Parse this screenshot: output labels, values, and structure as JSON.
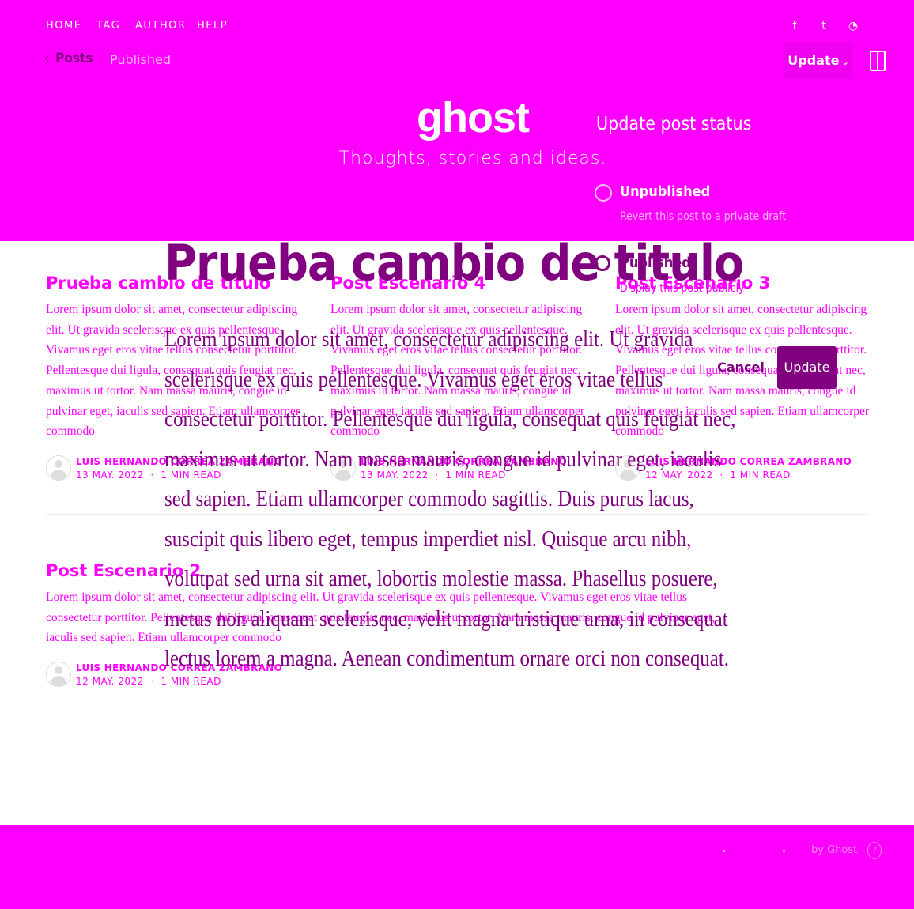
{
  "nav": {
    "items": [
      "HOME",
      "TAG",
      "AUTHOR",
      "HELP"
    ],
    "social": [
      {
        "icon": "facebook-icon",
        "glyph": "f"
      },
      {
        "icon": "twitter-icon",
        "glyph": "t"
      },
      {
        "icon": "rss-icon",
        "glyph": "◔"
      }
    ]
  },
  "editor_bar": {
    "back_label": "Posts",
    "status": "Published",
    "update_label": "Update"
  },
  "site": {
    "title": "ghost",
    "description": "Thoughts, stories and ideas."
  },
  "popup": {
    "title": "Update post status",
    "options": [
      {
        "title": "Unpublished",
        "description": "Revert this post to a private draft"
      },
      {
        "title": "Published",
        "description": "Display this post publicly"
      }
    ],
    "cancel_label": "Cancel",
    "confirm_label": "Update"
  },
  "editor": {
    "title": "Prueba cambio de titulo",
    "body": "Lorem ipsum dolor sit amet, consectetur adipiscing elit. Ut gravida scelerisque ex quis pellentesque. Vivamus eget eros vitae tellus consectetur porttitor. Pellentesque dui ligula, consequat quis feugiat nec, maximus ut tortor. Nam massa mauris, congue id pulvinar eget, iaculis sed sapien. Etiam ullamcorper commodo sagittis. Duis purus lacus, suscipit quis libero eget, tempus imperdiet nisl. Quisque arcu nibh, volutpat sed urna sit amet, lobortis molestie massa. Phasellus posuere, metus non aliquam scelerisque, velit magna tristique urna, in consequat lectus lorem a magna. Aenean condimentum ornare orci non consequat."
  },
  "posts": [
    {
      "title": "Prueba cambio de titulo",
      "excerpt": "Lorem ipsum dolor sit amet, consectetur adipiscing elit. Ut gravida scelerisque ex quis pellentesque. Vivamus eget eros vitae tellus consectetur porttitor. Pellentesque dui ligula, consequat quis feugiat nec, maximus ut tortor. Nam massa mauris, congue id pulvinar eget, iaculis sed sapien. Etiam ullamcorper commodo",
      "author": "LUIS HERNANDO CORREA ZAMBRANO",
      "date": "13 MAY. 2022",
      "read": "1 MIN READ"
    },
    {
      "title": "Post Escenario 4",
      "excerpt": "Lorem ipsum dolor sit amet, consectetur adipiscing elit. Ut gravida scelerisque ex quis pellentesque. Vivamus eget eros vitae tellus consectetur porttitor. Pellentesque dui ligula, consequat quis feugiat nec, maximus ut tortor. Nam massa mauris, congue id pulvinar eget, iaculis sed sapien. Etiam ullamcorper commodo",
      "author": "LUIS HERNANDO CORREA ZAMBRANO",
      "date": "13 MAY. 2022",
      "read": "1 MIN READ"
    },
    {
      "title": "Post Escenario 3",
      "excerpt": "Lorem ipsum dolor sit amet, consectetur adipiscing elit. Ut gravida scelerisque ex quis pellentesque. Vivamus eget eros vitae tellus consectetur porttitor. Pellentesque dui ligula, consequat quis feugiat nec, maximus ut tortor. Nam massa mauris, congue id pulvinar eget, iaculis sed sapien. Etiam ullamcorper commodo",
      "author": "LUIS HERNANDO CORREA ZAMBRANO",
      "date": "12 MAY. 2022",
      "read": "1 MIN READ"
    },
    {
      "title": "Post Escenario 2",
      "excerpt": "Lorem ipsum dolor sit amet, consectetur adipiscing elit. Ut gravida scelerisque ex quis pellentesque. Vivamus eget eros vitae tellus consectetur porttitor. Pellentesque dui ligula, consequat quis feugiat nec, maximus ut tortor. Nam massa mauris, congue id pulvinar eget, iaculis sed sapien. Etiam ullamcorper commodo",
      "author": "LUIS HERNANDO CORREA ZAMBRANO",
      "date": "12 MAY. 2022",
      "read": "1 MIN READ"
    }
  ],
  "footer": {
    "text": "by Ghost",
    "help": "?"
  }
}
